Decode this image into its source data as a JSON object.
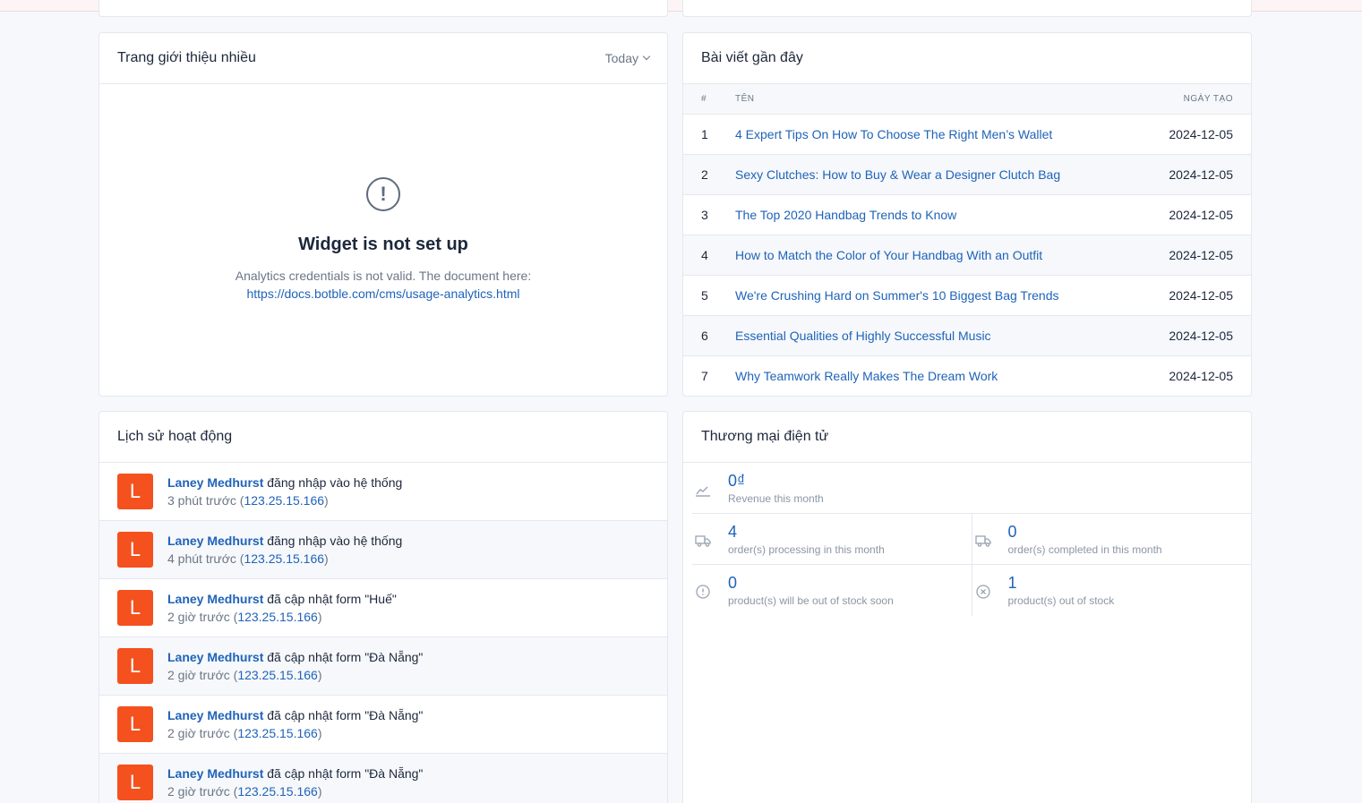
{
  "referrers_widget": {
    "title": "Trang giới thiệu nhiều",
    "filter_label": "Today",
    "empty_title": "Widget is not set up",
    "empty_desc": "Analytics credentials is not valid. The document here:",
    "empty_link": "https://docs.botble.com/cms/usage-analytics.html"
  },
  "recent_posts": {
    "title": "Bài viết gần đây",
    "columns": [
      "#",
      "TÊN",
      "NGÀY TẠO"
    ],
    "rows": [
      {
        "num": "1",
        "name": "4 Expert Tips On How To Choose The Right Men’s Wallet",
        "date": "2024-12-05"
      },
      {
        "num": "2",
        "name": "Sexy Clutches: How to Buy & Wear a Designer Clutch Bag",
        "date": "2024-12-05"
      },
      {
        "num": "3",
        "name": "The Top 2020 Handbag Trends to Know",
        "date": "2024-12-05"
      },
      {
        "num": "4",
        "name": "How to Match the Color of Your Handbag With an Outfit",
        "date": "2024-12-05"
      },
      {
        "num": "5",
        "name": "We're Crushing Hard on Summer's 10 Biggest Bag Trends",
        "date": "2024-12-05"
      },
      {
        "num": "6",
        "name": "Essential Qualities of Highly Successful Music",
        "date": "2024-12-05"
      },
      {
        "num": "7",
        "name": "Why Teamwork Really Makes The Dream Work",
        "date": "2024-12-05"
      }
    ]
  },
  "activity": {
    "title": "Lịch sử hoạt động",
    "items": [
      {
        "avatar": "L",
        "user": "Laney Medhurst",
        "action": " đăng nhập vào hệ thống",
        "time": "3 phút trước (",
        "ip": "123.25.15.166",
        "close": ")"
      },
      {
        "avatar": "L",
        "user": "Laney Medhurst",
        "action": " đăng nhập vào hệ thống",
        "time": "4 phút trước (",
        "ip": "123.25.15.166",
        "close": ")"
      },
      {
        "avatar": "L",
        "user": "Laney Medhurst",
        "action": " đã cập nhật form \"Huế\"",
        "time": "2 giờ trước (",
        "ip": "123.25.15.166",
        "close": ")"
      },
      {
        "avatar": "L",
        "user": "Laney Medhurst",
        "action": " đã cập nhật form \"Đà Nẵng\"",
        "time": "2 giờ trước (",
        "ip": "123.25.15.166",
        "close": ")"
      },
      {
        "avatar": "L",
        "user": "Laney Medhurst",
        "action": " đã cập nhật form \"Đà Nẵng\"",
        "time": "2 giờ trước (",
        "ip": "123.25.15.166",
        "close": ")"
      },
      {
        "avatar": "L",
        "user": "Laney Medhurst",
        "action": " đã cập nhật form \"Đà Nẵng\"",
        "time": "2 giờ trước (",
        "ip": "123.25.15.166",
        "close": ")"
      }
    ]
  },
  "ecommerce": {
    "title": "Thương mại điện tử",
    "revenue": {
      "value": "0₫",
      "label": "Revenue this month",
      "icon": "chart-line-icon"
    },
    "processing": {
      "value": "4",
      "label": "order(s) processing in this month",
      "icon": "truck-icon"
    },
    "completed": {
      "value": "0",
      "label": "order(s) completed in this month",
      "icon": "truck-icon"
    },
    "low_stock": {
      "value": "0",
      "label": "product(s) will be out of stock soon",
      "icon": "alert-circle-icon"
    },
    "out_stock": {
      "value": "1",
      "label": "product(s) out of stock",
      "icon": "x-circle-icon"
    }
  },
  "colors": {
    "accent": "#1f63b8",
    "avatar": "#f4511e"
  }
}
